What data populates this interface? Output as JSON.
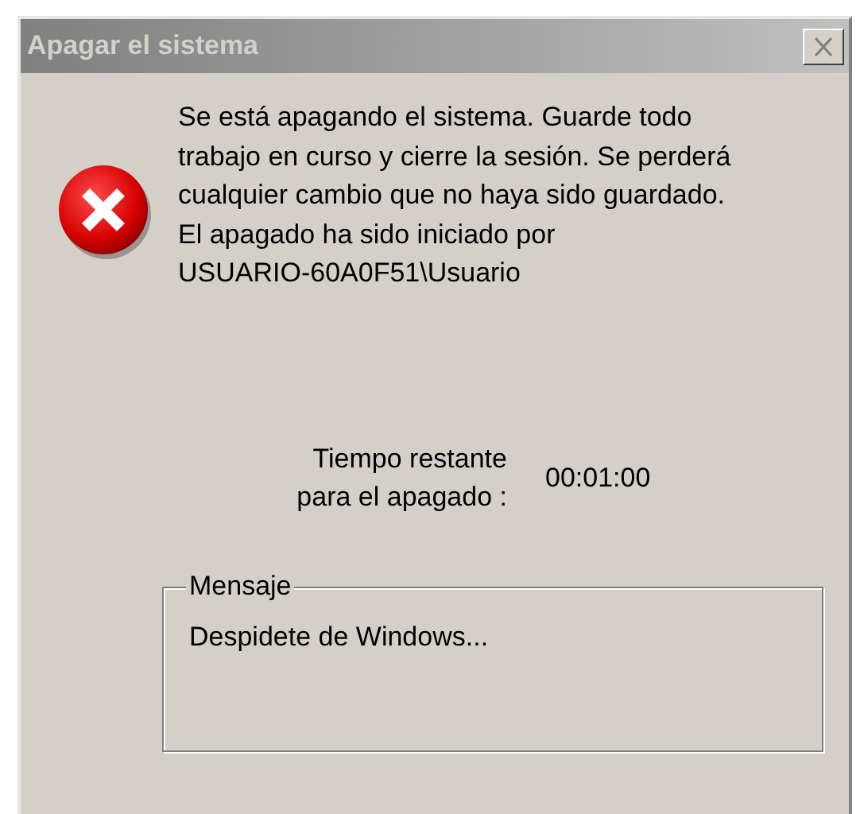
{
  "window": {
    "title": "Apagar el sistema",
    "active": false
  },
  "message_lines": [
    "Se está apagando el sistema. Guarde todo",
    "trabajo en curso y cierre la sesión. Se perderá",
    "cualquier cambio que no haya sido guardado.",
    "El apagado ha sido iniciado por",
    "USUARIO-60A0F51\\Usuario"
  ],
  "countdown": {
    "label_lines": [
      "Tiempo restante",
      "para el apagado :"
    ],
    "value": "00:01:00"
  },
  "message_group": {
    "legend": "Mensaje",
    "text": "Despidete de Windows..."
  }
}
